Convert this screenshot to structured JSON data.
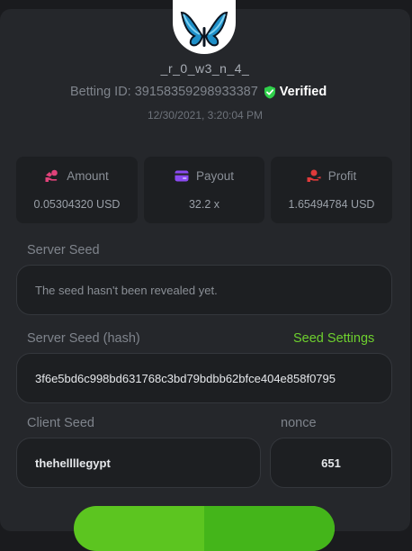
{
  "user": {
    "username": "_r_0_w3_n_4_",
    "betting_id_label": "Betting ID:",
    "betting_id": "39158359298933387",
    "verified_label": "Verified",
    "timestamp": "12/30/2021, 3:20:04 PM"
  },
  "stats": {
    "amount": {
      "label": "Amount",
      "value": "0.05304320 USD",
      "icon": "hand-coins-icon",
      "color": "#e0427a"
    },
    "payout": {
      "label": "Payout",
      "value": "32.2 x",
      "icon": "wallet-card-icon",
      "color": "#8a4af0"
    },
    "profit": {
      "label": "Profit",
      "value": "1.65494784 USD",
      "icon": "coins-hand-icon",
      "color": "#e03a3a"
    }
  },
  "server_seed": {
    "label": "Server Seed",
    "placeholder": "The seed hasn't been revealed yet."
  },
  "server_seed_hash": {
    "label": "Server Seed (hash)",
    "settings_link": "Seed Settings",
    "value": "3f6e5bd6c998bd631768c3bd79bdbb62bfce404e858f0795"
  },
  "client_seed": {
    "label": "Client Seed",
    "value": "thehellllegypt"
  },
  "nonce": {
    "label": "nonce",
    "value": "651"
  },
  "colors": {
    "accent": "#6ed02e",
    "verified": "#2fcf4a"
  }
}
